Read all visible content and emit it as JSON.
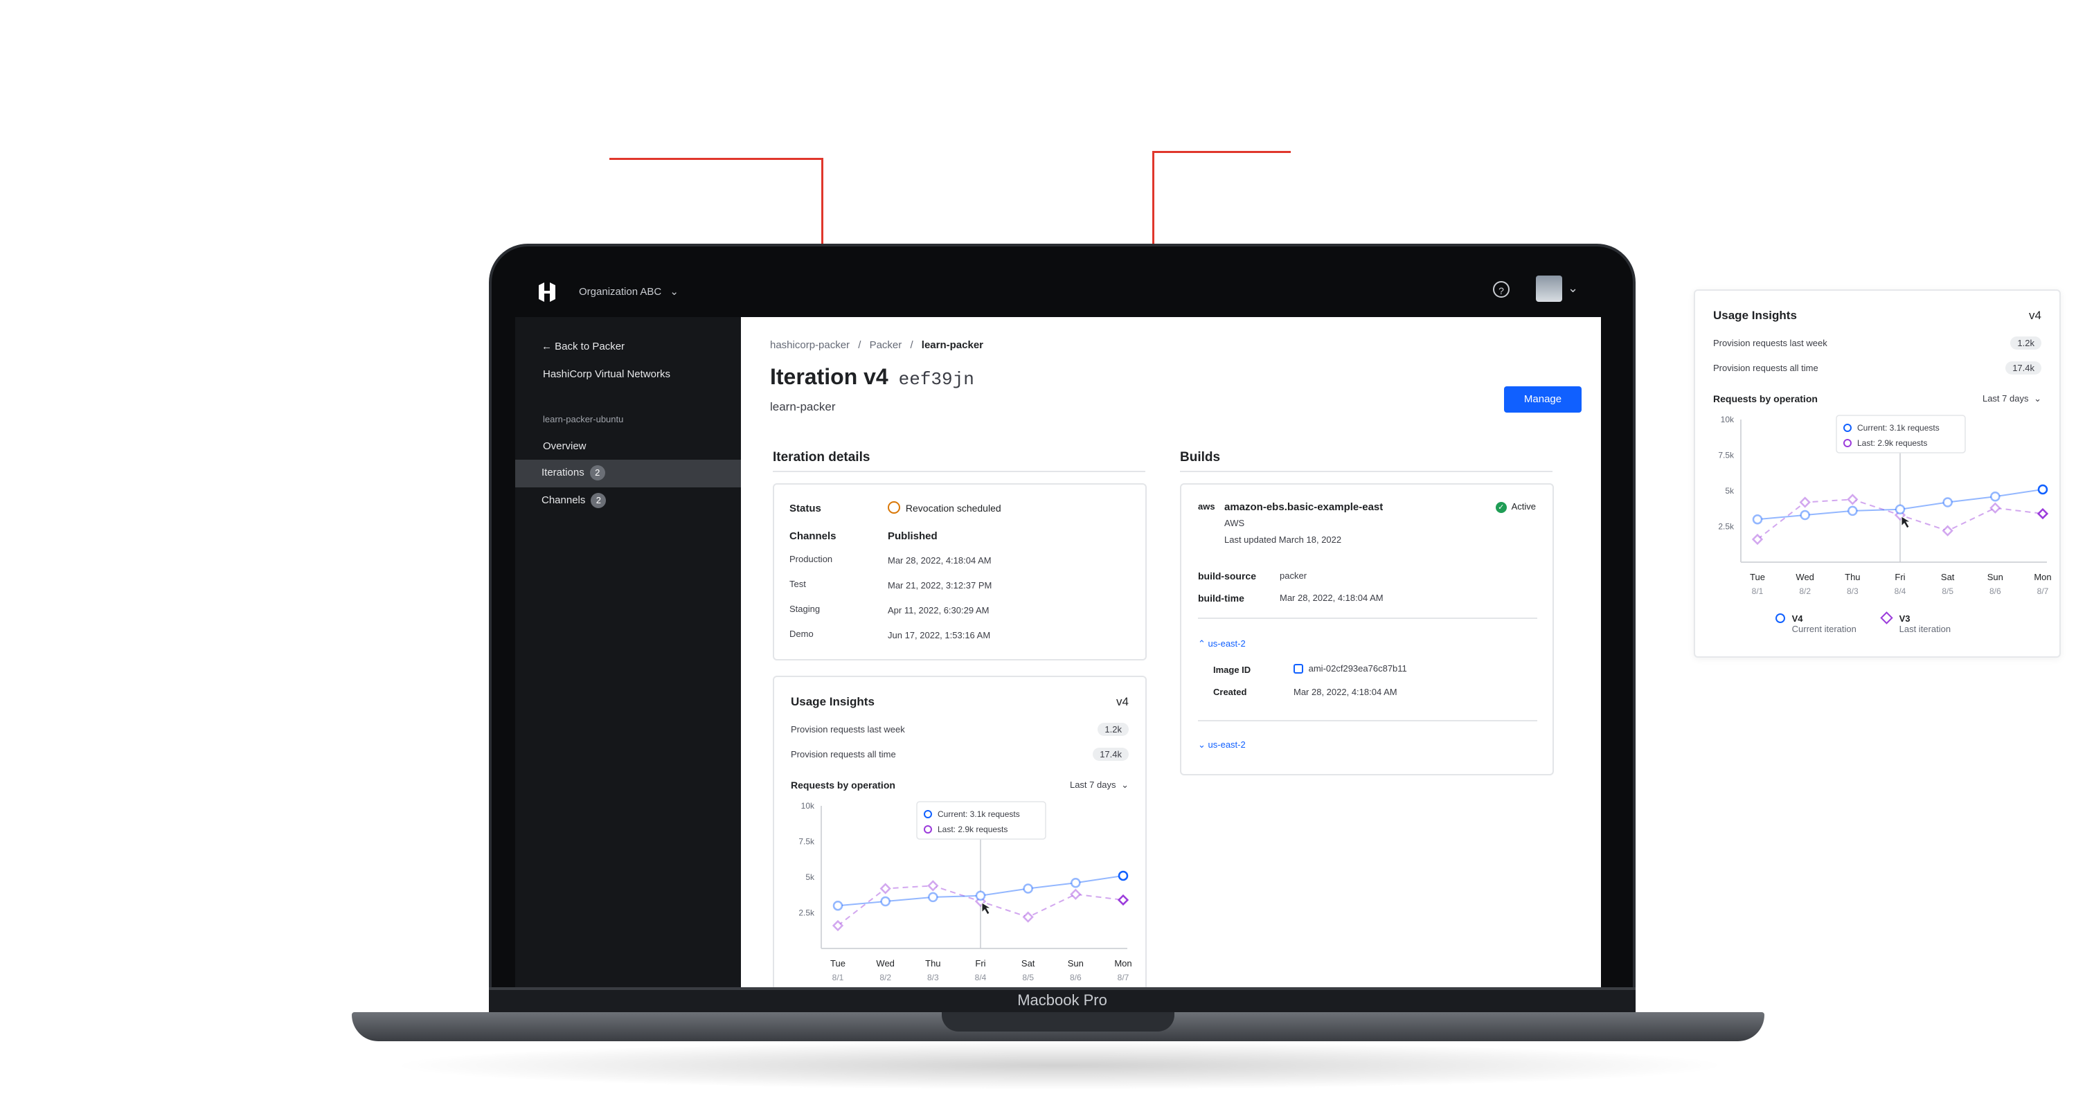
{
  "app": {
    "org": "Organization ABC",
    "device_label": "Macbook Pro"
  },
  "sidebar": {
    "back": "Back to Packer",
    "project": "HashiCorp Virtual Networks",
    "bucket": "learn-packer-ubuntu",
    "items": [
      {
        "label": "Overview"
      },
      {
        "label": "Iterations",
        "count": "2"
      },
      {
        "label": "Channels",
        "count": "2"
      }
    ]
  },
  "breadcrumb": [
    "hashicorp-packer",
    "/",
    "Packer",
    "/",
    "learn-packer"
  ],
  "page": {
    "title": "Iteration v4",
    "fingerprint": "eef39jn",
    "subtitle": "learn-packer",
    "manage": "Manage"
  },
  "iteration_details": {
    "heading": "Iteration details",
    "status_label": "Status",
    "status_value": "Revocation scheduled",
    "channels_label": "Channels",
    "channels_value": "Published",
    "rows": [
      {
        "label": "Production",
        "value": "Mar 28, 2022, 4:18:04 AM"
      },
      {
        "label": "Test",
        "value": "Mar 21, 2022, 3:12:37 PM"
      },
      {
        "label": "Staging",
        "value": "Apr 11, 2022, 6:30:29 AM"
      },
      {
        "label": "Demo",
        "value": "Jun 17, 2022, 1:53:16 AM"
      }
    ]
  },
  "builds": {
    "heading": "Builds",
    "aws_logo": "aws",
    "name": "amazon-ebs.basic-example-east",
    "provider": "AWS",
    "updated": "Last updated March 18, 2022",
    "status": "Active",
    "kv": [
      {
        "label": "build-source",
        "value": "packer"
      },
      {
        "label": "build-time",
        "value": "Mar 28, 2022, 4:18:04 AM"
      }
    ],
    "region1": "us-east-2",
    "image_label": "Image ID",
    "image_value": "ami-02cf293ea76c87b11",
    "created_label": "Created",
    "created_value": "Mar 28, 2022, 4:18:04 AM",
    "region2": "us-east-2"
  },
  "usage": {
    "title": "Usage Insights",
    "version": "v4",
    "week_label": "Provision requests last week",
    "week_value": "1.2k",
    "all_label": "Provision requests all time",
    "all_value": "17.4k",
    "requests_label": "Requests by operation",
    "range": "Last 7 days",
    "tooltip_current": "Current: 3.1k requests",
    "tooltip_last": "Last: 2.9k requests",
    "legend": [
      {
        "name": "V4",
        "desc": "Current iteration"
      },
      {
        "name": "V3",
        "desc": "Last iteration"
      }
    ]
  },
  "colors": {
    "accent": "#1060ff",
    "callout": "#e0372c",
    "series_v4": "#1060ff",
    "series_v3": "#9b3bdb",
    "active": "#1f9d55",
    "warning": "#d97706"
  },
  "chart_data": {
    "type": "line",
    "categories": [
      "Tue",
      "Wed",
      "Thu",
      "Fri",
      "Sat",
      "Sun",
      "Mon"
    ],
    "sublabels": [
      "8/1",
      "8/2",
      "8/3",
      "8/4",
      "8/5",
      "8/6",
      "8/7"
    ],
    "yticks": [
      "10k",
      "7.5k",
      "5k",
      "2.5k"
    ],
    "ylim": [
      0,
      10000
    ],
    "series": [
      {
        "name": "V4",
        "values": [
          3000,
          3300,
          3600,
          3700,
          4200,
          4600,
          5100
        ]
      },
      {
        "name": "V3",
        "values": [
          1600,
          4200,
          4400,
          3300,
          2200,
          3800,
          3400
        ]
      }
    ]
  }
}
